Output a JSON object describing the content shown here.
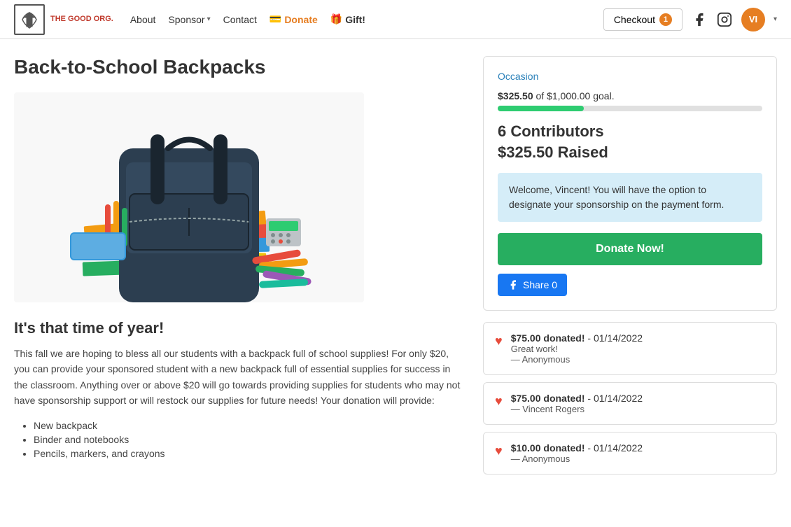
{
  "nav": {
    "logo_text_line1": "THE GOOD ORG.",
    "links": [
      {
        "label": "About",
        "name": "about"
      },
      {
        "label": "Sponsor",
        "name": "sponsor",
        "has_dropdown": true
      },
      {
        "label": "Contact",
        "name": "contact"
      },
      {
        "label": "Donate",
        "name": "donate",
        "icon": "💳"
      },
      {
        "label": "Gift!",
        "name": "gift",
        "icon": "🎁"
      }
    ],
    "checkout_label": "Checkout",
    "checkout_count": "1",
    "user_initials": "VI"
  },
  "page": {
    "title": "Back-to-School Backpacks"
  },
  "campaign": {
    "occasion_label": "Occasion",
    "raised_amount": "$325.50",
    "goal_amount": "$1,000.00",
    "goal_text": " of $1,000.00 goal.",
    "progress_percent": 32.55,
    "contributors": "6 Contributors",
    "raised_label": "$325.50 Raised",
    "welcome_message": "Welcome, Vincent! You will have the option to designate your sponsorship on the payment form.",
    "donate_button": "Donate Now!",
    "fb_share_label": "Share 0"
  },
  "content": {
    "subtitle": "It's that time of year!",
    "body": "This fall we are hoping to bless all our students with a backpack full of school supplies! For only $20, you can provide your sponsored student with a new backpack full of essential supplies for success in the classroom. Anything over or above $20 will go towards providing supplies for students who may not have sponsorship support or will restock our supplies for future needs! Your donation will provide:",
    "list_items": [
      "New backpack",
      "Binder and notebooks",
      "Pencils, markers, and crayons"
    ]
  },
  "donations": [
    {
      "amount": "$75.00 donated!",
      "date": "01/14/2022",
      "message": "Great work!",
      "donor": "— Anonymous"
    },
    {
      "amount": "$75.00 donated!",
      "date": "01/14/2022",
      "message": "",
      "donor": "— Vincent Rogers"
    },
    {
      "amount": "$10.00 donated!",
      "date": "01/14/2022",
      "message": "",
      "donor": "— Anonymous"
    }
  ]
}
